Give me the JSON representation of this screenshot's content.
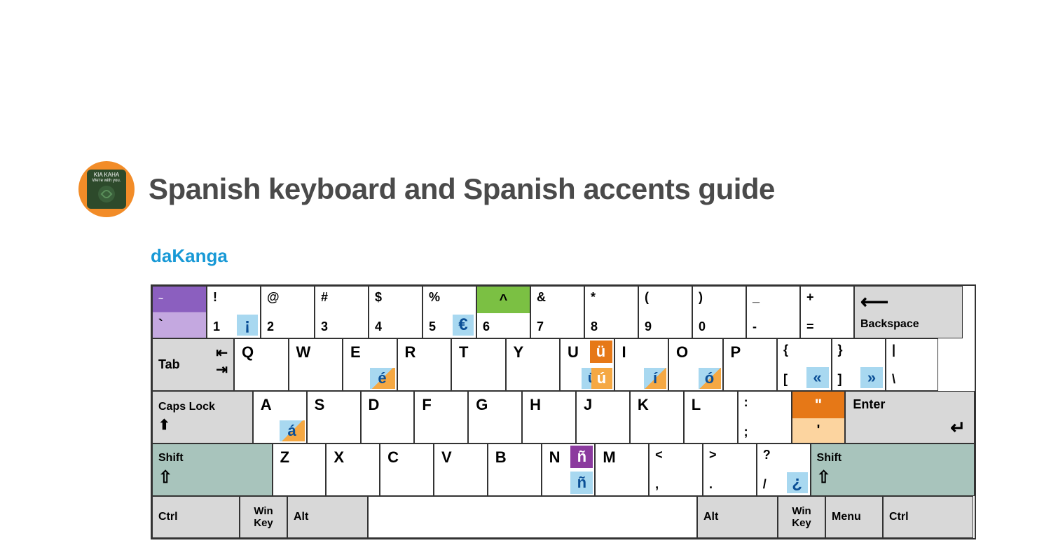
{
  "header": {
    "title": "Spanish keyboard and Spanish accents guide",
    "author": "daKanga",
    "avatar_line1": "KIA KAHA",
    "avatar_line2": "We're with you."
  },
  "row1": {
    "tilde_top": "~",
    "tilde_bot": "`",
    "k1u": "!",
    "k1l": "1",
    "k1a": "¡",
    "k2u": "@",
    "k2l": "2",
    "k3u": "#",
    "k3l": "3",
    "k4u": "$",
    "k4l": "4",
    "k5u": "%",
    "k5l": "5",
    "k5a": "€",
    "k6u": "^",
    "k6l": "6",
    "k7u": "&",
    "k7l": "7",
    "k8u": "*",
    "k8l": "8",
    "k9u": "(",
    "k9l": "9",
    "k10u": ")",
    "k10l": "0",
    "k11u": "_",
    "k11l": "-",
    "k12u": "+",
    "k12l": "=",
    "backspace": "Backspace"
  },
  "row2": {
    "tab": "Tab",
    "q": "Q",
    "w": "W",
    "e": "E",
    "ea": "é",
    "r": "R",
    "t": "T",
    "y": "Y",
    "u": "U",
    "ua": "ü",
    "uaU": "ü",
    "uacute": "ú",
    "i": "I",
    "ia": "í",
    "o": "O",
    "oa": "ó",
    "p": "P",
    "lb_u": "{",
    "lb_l": "[",
    "lba": "«",
    "rb_u": "}",
    "rb_l": "]",
    "rba": "»",
    "bs_u": "|",
    "bs_l": "\\"
  },
  "row3": {
    "caps": "Caps Lock",
    "a": "A",
    "aa": "á",
    "s": "S",
    "d": "D",
    "f": "F",
    "g": "G",
    "h": "H",
    "j": "J",
    "k": "K",
    "l": "L",
    "sc_u": ":",
    "sc_l": ";",
    "qt_u": "\"",
    "qt_l": "'",
    "enter": "Enter"
  },
  "row4": {
    "shift": "Shift",
    "z": "Z",
    "x": "X",
    "c": "C",
    "v": "V",
    "b": "B",
    "n": "N",
    "nU": "ñ",
    "nL": "ñ",
    "m": "M",
    "cm_u": "<",
    "cm_l": ",",
    "pd_u": ">",
    "pd_l": ".",
    "sl_u": "?",
    "sl_l": "/",
    "sla": "¿",
    "shiftr": "Shift"
  },
  "row5": {
    "ctrl": "Ctrl",
    "win": "Win\nKey",
    "alt": "Alt",
    "altr": "Alt",
    "winr": "Win\nKey",
    "menu": "Menu",
    "ctrlr": "Ctrl"
  }
}
